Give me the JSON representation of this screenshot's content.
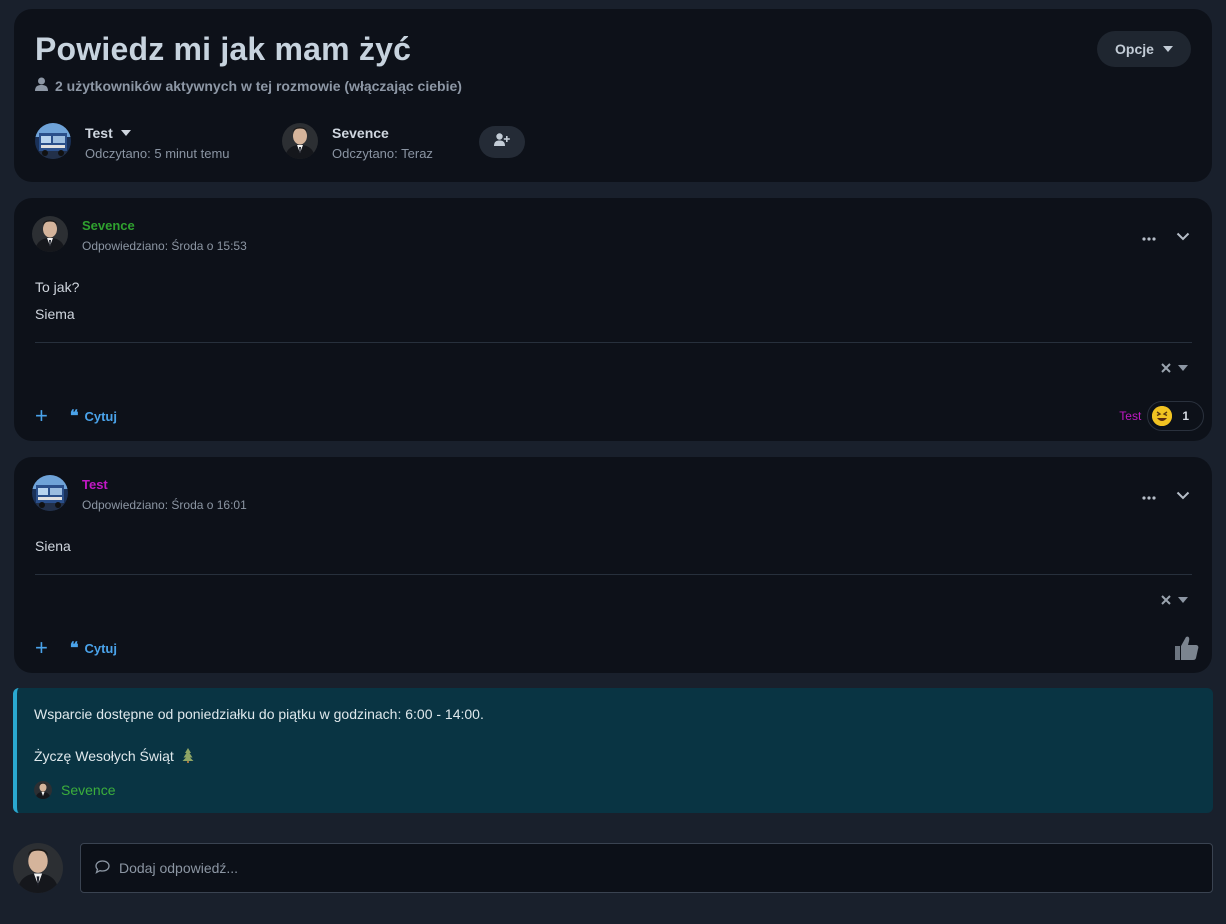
{
  "header": {
    "title": "Powiedz mi jak mam żyć",
    "active_users": "2 użytkowników aktywnych w tej rozmowie (włączając ciebie)",
    "options_label": "Opcje",
    "participants": [
      {
        "name": "Test",
        "read": "Odczytano: 5 minut temu",
        "has_dropdown": true
      },
      {
        "name": "Sevence",
        "read": "Odczytano: Teraz",
        "has_dropdown": false
      }
    ]
  },
  "messages": [
    {
      "author": "Sevence",
      "author_color": "#2fa12f",
      "date": "Odpowiedziano: Środa o 15:53",
      "lines": [
        "To jak?",
        "Siema"
      ],
      "quote_label": "Cytuj",
      "reaction": {
        "user": "Test",
        "emoji": "grinning-squinting-face",
        "count": "1"
      }
    },
    {
      "author": "Test",
      "author_color": "#c118c4",
      "date": "Odpowiedziano: Środa o 16:01",
      "lines": [
        "Siena"
      ],
      "quote_label": "Cytuj",
      "reaction": null
    }
  ],
  "banner": {
    "line1": "Wsparcie dostępne od poniedziałku do piątku w godzinach: 6:00 - 14:00.",
    "line2": "Życzę Wesołych Świąt",
    "signature": "Sevence",
    "accent": "#2aa8d0",
    "background": "#093443"
  },
  "reply": {
    "placeholder": "Dodaj odpowiedź..."
  },
  "icons": {
    "user": "user-icon",
    "add_user": "user-plus-icon",
    "more": "ellipsis-icon",
    "collapse": "chevron-down-icon",
    "close": "close-icon",
    "plus": "plus-icon",
    "quote": "quote-icon",
    "like": "thumbs-up-icon",
    "comment": "speech-bubble-icon",
    "tree": "christmas-tree-icon"
  }
}
